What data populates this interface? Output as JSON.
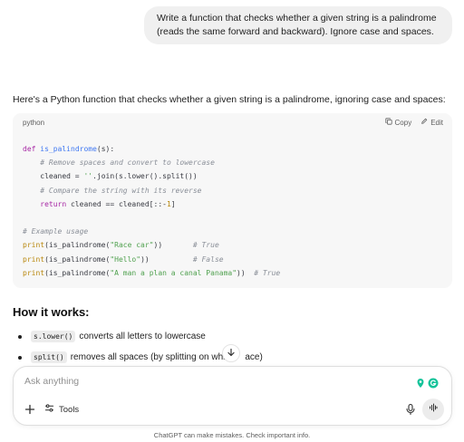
{
  "conversation": {
    "user_message": "Write a function that checks whether a given string is a palindrome (reads the same forward and backward). Ignore case and spaces.",
    "assistant_intro": "Here's a Python function that checks whether a given string is a palindrome, ignoring case and spaces:"
  },
  "code_block": {
    "language": "python",
    "copy_label": "Copy",
    "edit_label": "Edit"
  },
  "how_it_works": {
    "title": "How it works:",
    "bullets": [
      {
        "code": "s.lower()",
        "text": "converts all letters to lowercase"
      },
      {
        "code": "split()",
        "text": "removes all spaces (by splitting on whi",
        "tail": "ace)"
      }
    ]
  },
  "composer": {
    "placeholder": "Ask anything",
    "tools_label": "Tools"
  },
  "footer": {
    "disclaimer": "ChatGPT can make mistakes. Check important info."
  },
  "icons": {
    "copy": "copy-icon",
    "edit": "edit-icon",
    "scroll_down": "arrow-down-icon",
    "plus": "plus-icon",
    "tools": "tools-icon",
    "mic": "microphone-icon",
    "voice": "voice-mode-icon",
    "extensions": [
      "location-pin-icon",
      "grammarly-icon"
    ]
  },
  "colors": {
    "accent_green": "#15c39a",
    "user_bubble_bg": "#f0f0f0",
    "code_bg": "#f7f7f7"
  }
}
